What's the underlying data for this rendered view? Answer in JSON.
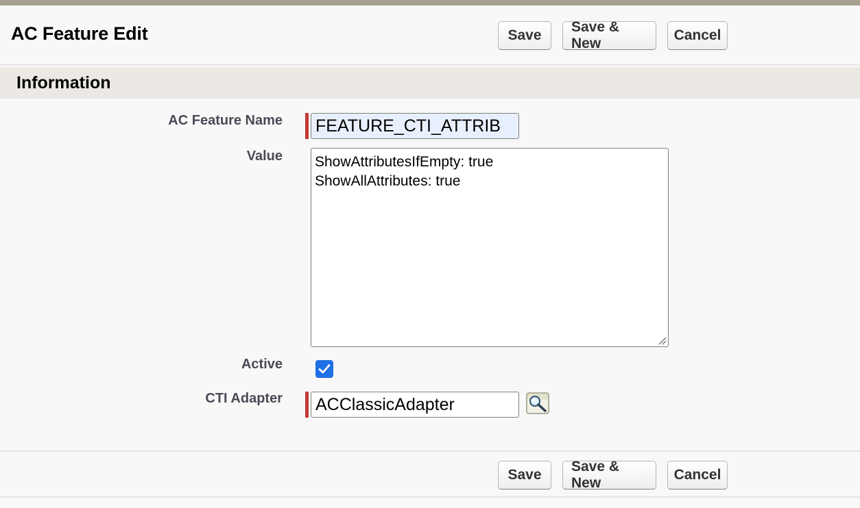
{
  "page": {
    "title": "AC Feature Edit"
  },
  "toolbar": {
    "save_label": "Save",
    "save_new_label": "Save & New",
    "cancel_label": "Cancel"
  },
  "section": {
    "title": "Information"
  },
  "fields": {
    "feature_name": {
      "label": "AC Feature Name",
      "value": "FEATURE_CTI_ATTRIB",
      "required": true
    },
    "value": {
      "label": "Value",
      "lines": [
        "ShowAttributesIfEmpty: true",
        "ShowAllAttributes: true"
      ]
    },
    "active": {
      "label": "Active",
      "checked": true
    },
    "cti_adapter": {
      "label": "CTI Adapter",
      "value": "ACClassicAdapter",
      "required": true
    }
  },
  "icons": {
    "lookup": "lookup-magnifier-icon",
    "check": "checkmark-icon"
  },
  "colors": {
    "top_rule": "#a49f8e",
    "section_header_bg": "#ece9e4",
    "required_marker": "#c23934",
    "checkbox": "#1f6fe5"
  }
}
